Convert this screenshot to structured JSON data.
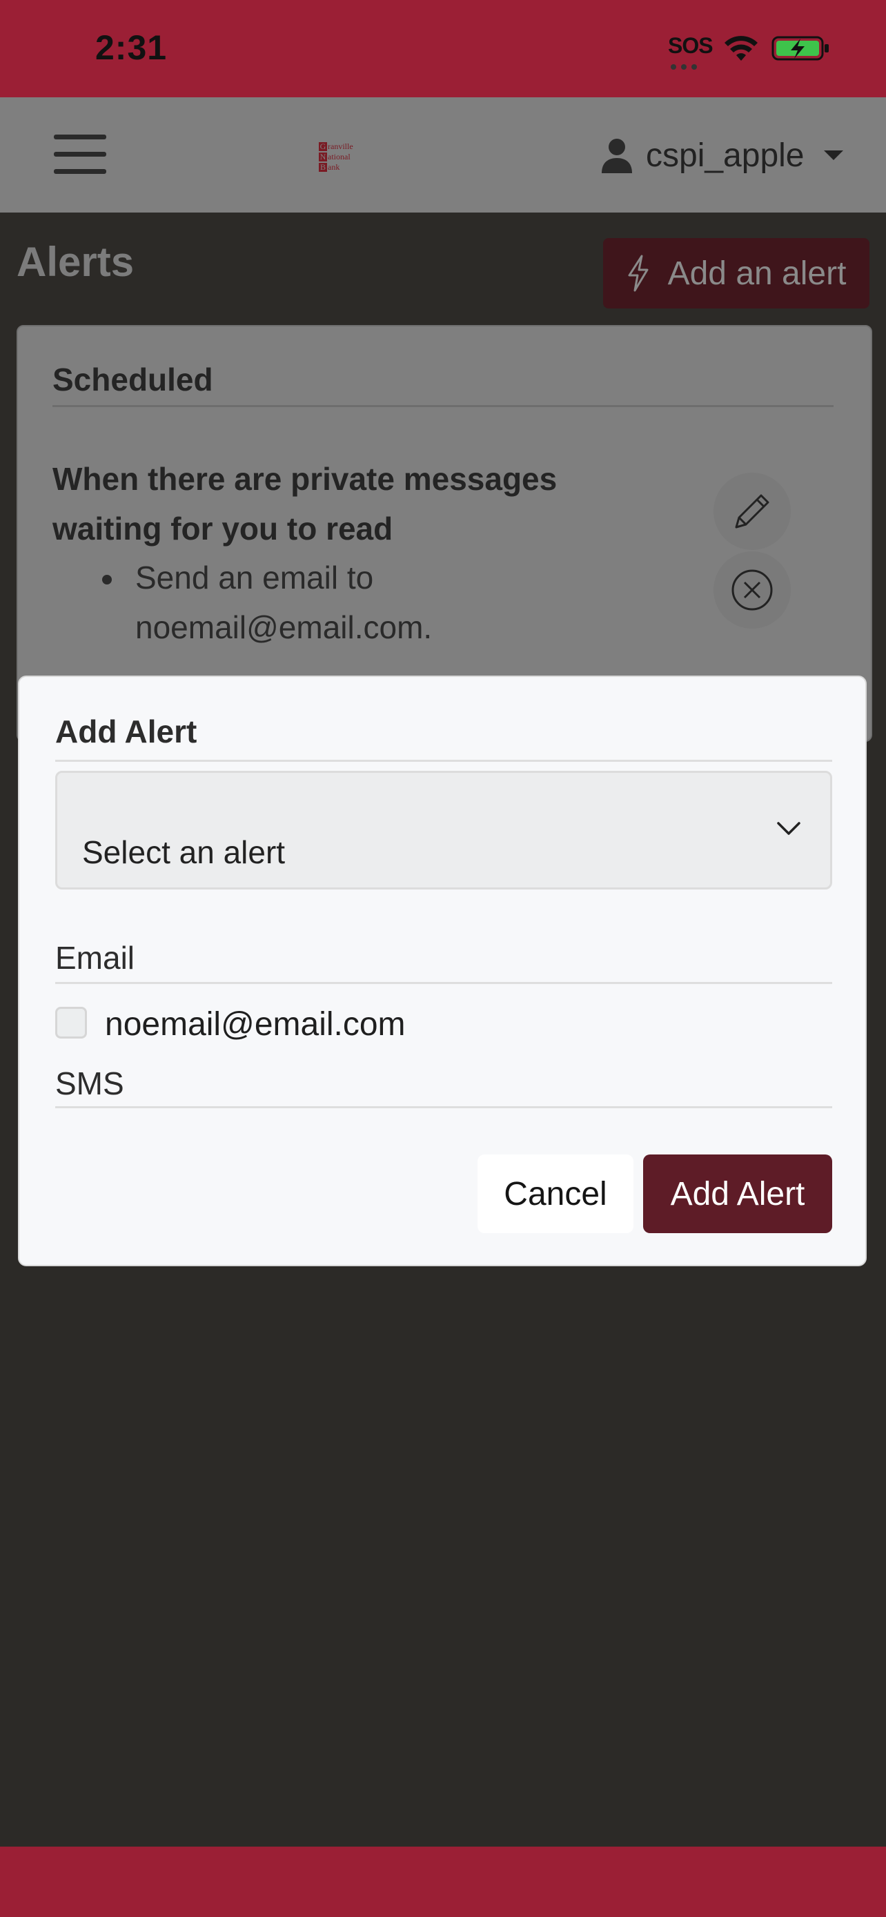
{
  "status_bar": {
    "time": "2:31",
    "sos": "SOS"
  },
  "navbar": {
    "logo_lines": [
      "ranville",
      "ational",
      "ank"
    ],
    "logo_initials": [
      "G",
      "N",
      "B"
    ],
    "username": "cspi_apple"
  },
  "page": {
    "title": "Alerts",
    "add_button_label": "Add an alert"
  },
  "scheduled_card": {
    "section_title": "Scheduled",
    "alert_description": "When there are private messages waiting for you to read",
    "actions": [
      "Send an email to noemail@email.com."
    ]
  },
  "modal": {
    "title": "Add Alert",
    "select_value": "Select an alert",
    "email_label": "Email",
    "email_option": "noemail@email.com",
    "email_checked": false,
    "sms_label": "SMS",
    "cancel_label": "Cancel",
    "submit_label": "Add Alert"
  },
  "colors": {
    "brand_red": "#9b1f35",
    "button_dark_red": "#5e1c27",
    "overlay_bg": "#2c2a27"
  },
  "icons": [
    "wifi-icon",
    "battery-charging-icon",
    "menu-icon",
    "user-icon",
    "caret-down-icon",
    "lightning-icon",
    "pencil-icon",
    "close-circle-icon",
    "chevron-down-icon"
  ]
}
